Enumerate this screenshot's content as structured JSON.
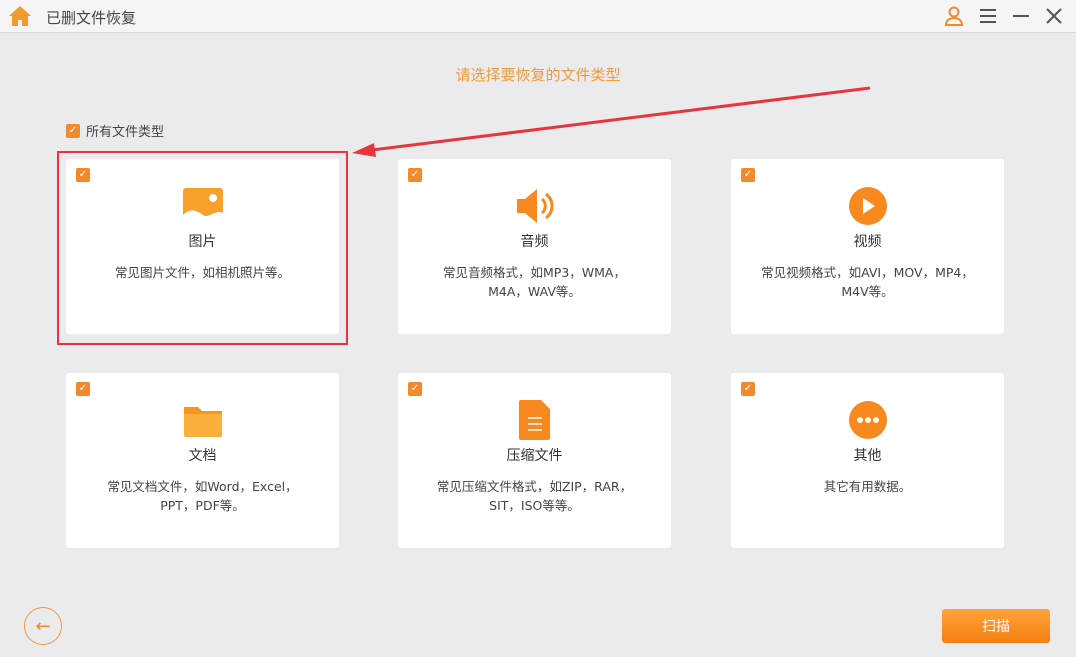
{
  "app": {
    "title": "已删文件恢复"
  },
  "prompt": "请选择要恢复的文件类型",
  "all_types": {
    "label": "所有文件类型",
    "checked": true
  },
  "cards": [
    {
      "name": "图片",
      "desc": "常见图片文件，如相机照片等。",
      "icon": "image-icon",
      "checked": true
    },
    {
      "name": "音频",
      "desc": "常见音频格式，如MP3，WMA，M4A，WAV等。",
      "icon": "speaker-icon",
      "checked": true
    },
    {
      "name": "视频",
      "desc": "常见视频格式，如AVI，MOV，MP4，M4V等。",
      "icon": "play-icon",
      "checked": true
    },
    {
      "name": "文档",
      "desc": "常见文档文件，如Word，Excel，PPT，PDF等。",
      "icon": "folder-icon",
      "checked": true
    },
    {
      "name": "压缩文件",
      "desc": "常见压缩文件格式，如ZIP，RAR，SIT，ISO等等。",
      "icon": "file-icon",
      "checked": true
    },
    {
      "name": "其他",
      "desc": "其它有用数据。",
      "icon": "more-icon",
      "checked": true
    }
  ],
  "buttons": {
    "scan": "扫描",
    "back": "←"
  },
  "colors": {
    "accent": "#f08a2c",
    "highlight": "#e8353b"
  }
}
